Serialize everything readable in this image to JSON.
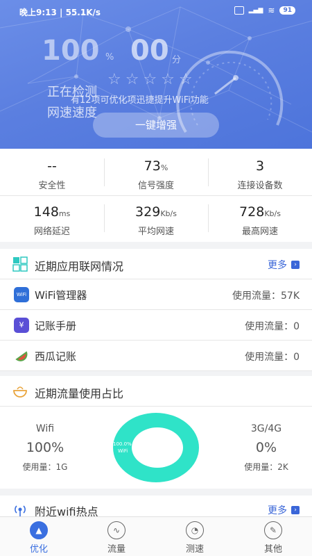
{
  "status_bar": {
    "time": "晚上9:13 | 55.1K/s",
    "battery": "91"
  },
  "hero": {
    "score_value": "100",
    "score_unit": "%",
    "minutes_value": "00",
    "minutes_unit": "分",
    "stars": "☆☆☆☆☆",
    "checking_text": "正在检测",
    "tip_text": "有12项可优化项迅捷提升WiFi功能",
    "speed_text": "网速速度",
    "boost_button": "一键增强"
  },
  "stats": [
    {
      "value": "--",
      "unit": "",
      "label": "安全性"
    },
    {
      "value": "73",
      "unit": "%",
      "label": "信号强度"
    },
    {
      "value": "3",
      "unit": "",
      "label": "连接设备数"
    },
    {
      "value": "148",
      "unit": "ms",
      "label": "网络延迟"
    },
    {
      "value": "329",
      "unit": "Kb/s",
      "label": "平均网速"
    },
    {
      "value": "728",
      "unit": "Kb/s",
      "label": "最高网速"
    }
  ],
  "apps_section": {
    "title": "近期应用联网情况",
    "more": "更多",
    "rows": [
      {
        "name": "WiFi管理器",
        "usage": "使用流量：57K",
        "icon": "wifi-manager-icon",
        "color": "#2f6fd8"
      },
      {
        "name": "记账手册",
        "usage": "使用流量：0",
        "icon": "ledger-icon",
        "color": "#5a4fd6"
      },
      {
        "name": "西瓜记账",
        "usage": "使用流量：0",
        "icon": "watermelon-icon",
        "color": "#e0533f"
      }
    ]
  },
  "traffic_section": {
    "title": "近期流量使用占比",
    "left": {
      "type": "Wifi",
      "percent": "100%",
      "usage": "使用量：1G"
    },
    "right": {
      "type": "3G/4G",
      "percent": "0%",
      "usage": "使用量：2K"
    },
    "donut_center_top": "100.0%",
    "donut_center_bottom": "WiFi",
    "donut_color": "#2fe3c8"
  },
  "hotspot_section": {
    "title": "附近wifi热点",
    "more": "更多"
  },
  "tabs": [
    {
      "label": "优化",
      "icon": "rocket-icon",
      "active": true
    },
    {
      "label": "流量",
      "icon": "pulse-icon",
      "active": false
    },
    {
      "label": "测速",
      "icon": "speedometer-icon",
      "active": false
    },
    {
      "label": "其他",
      "icon": "settings-icon",
      "active": false
    }
  ]
}
